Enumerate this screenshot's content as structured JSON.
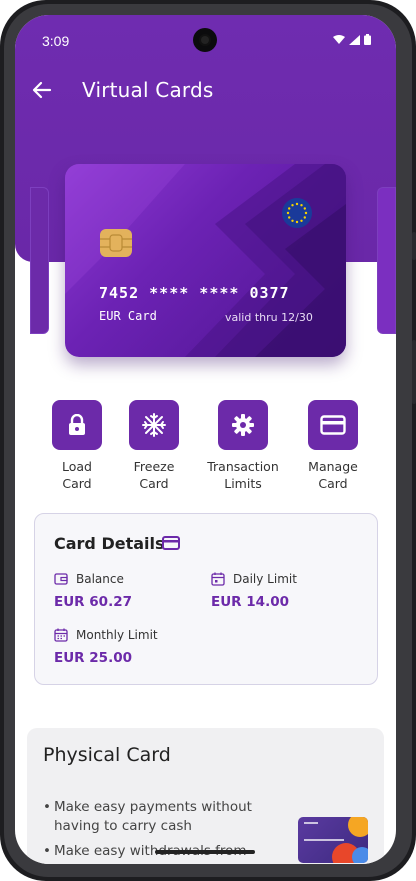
{
  "status_bar": {
    "time": "3:09"
  },
  "app_bar": {
    "title": "Virtual Cards"
  },
  "card": {
    "number": "7452 **** **** 0377",
    "label": "EUR Card",
    "valid": "valid thru 12/30"
  },
  "actions": [
    {
      "label": "Load\nCard",
      "icon": "lock-icon"
    },
    {
      "label": "Freeze\nCard",
      "icon": "snowflake-icon"
    },
    {
      "label": "Transaction\nLimits",
      "icon": "gear-icon"
    },
    {
      "label": "Manage\nCard",
      "icon": "credit-card-icon"
    }
  ],
  "card_details": {
    "title": "Card Details",
    "balance": {
      "label": "Balance",
      "value": "EUR 60.27"
    },
    "daily_limit": {
      "label": "Daily Limit",
      "value": "EUR 14.00"
    },
    "monthly_limit": {
      "label": "Monthly Limit",
      "value": "EUR 25.00"
    }
  },
  "physical_card": {
    "title": "Physical Card",
    "bullets": [
      "Make easy payments without having to carry cash",
      "Make easy withdrawals from anywhere in the world"
    ]
  },
  "colors": {
    "primary": "#6c2aa9",
    "chip": "#e3b25c"
  }
}
